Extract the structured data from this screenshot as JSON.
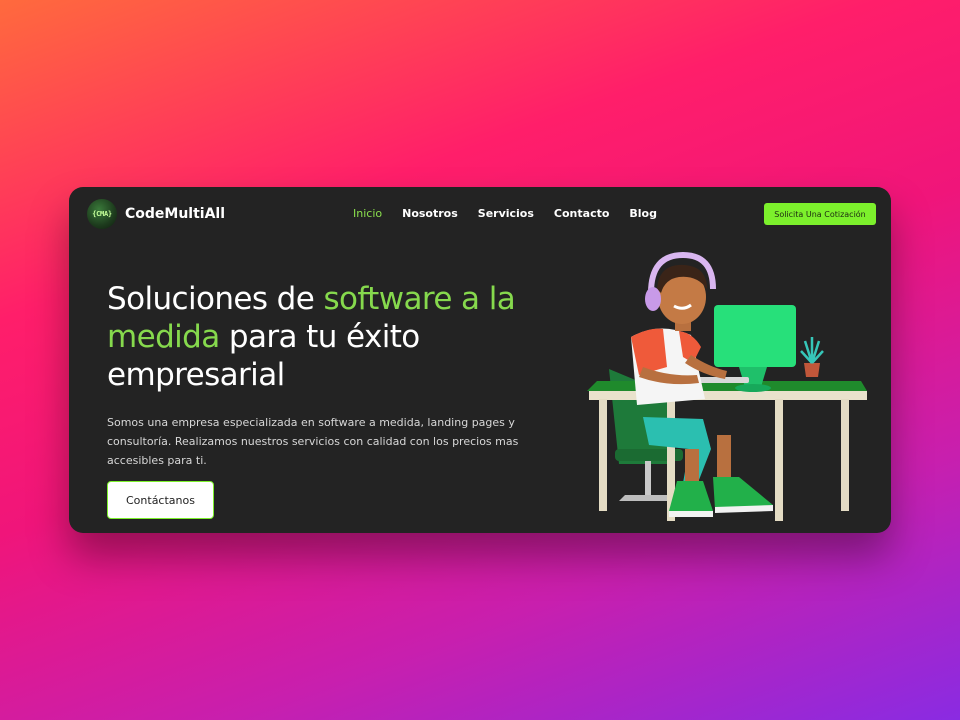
{
  "brand": {
    "logo_text": "{CMA}",
    "name": "CodeMultiAll"
  },
  "nav": {
    "items": [
      {
        "label": "Inicio",
        "active": true
      },
      {
        "label": "Nosotros",
        "active": false
      },
      {
        "label": "Servicios",
        "active": false
      },
      {
        "label": "Contacto",
        "active": false
      },
      {
        "label": "Blog",
        "active": false
      }
    ],
    "quote_button": "Solicita Una Cotización"
  },
  "hero": {
    "title_part1": "Soluciones de ",
    "title_highlight1": "software a la",
    "title_highlight2": "medida",
    "title_part2": " para tu éxito empresarial",
    "description": "Somos una empresa especializada en software a medida, landing pages y consultoría. Realizamos nuestros servicios con calidad con los precios mas accesibles para ti.",
    "cta_label": "Contáctanos"
  },
  "colors": {
    "accent": "#7cf02c",
    "highlight_text": "#86d94d",
    "card_bg": "#232323"
  },
  "illustration": {
    "icon": "developer-at-desk-illustration"
  }
}
